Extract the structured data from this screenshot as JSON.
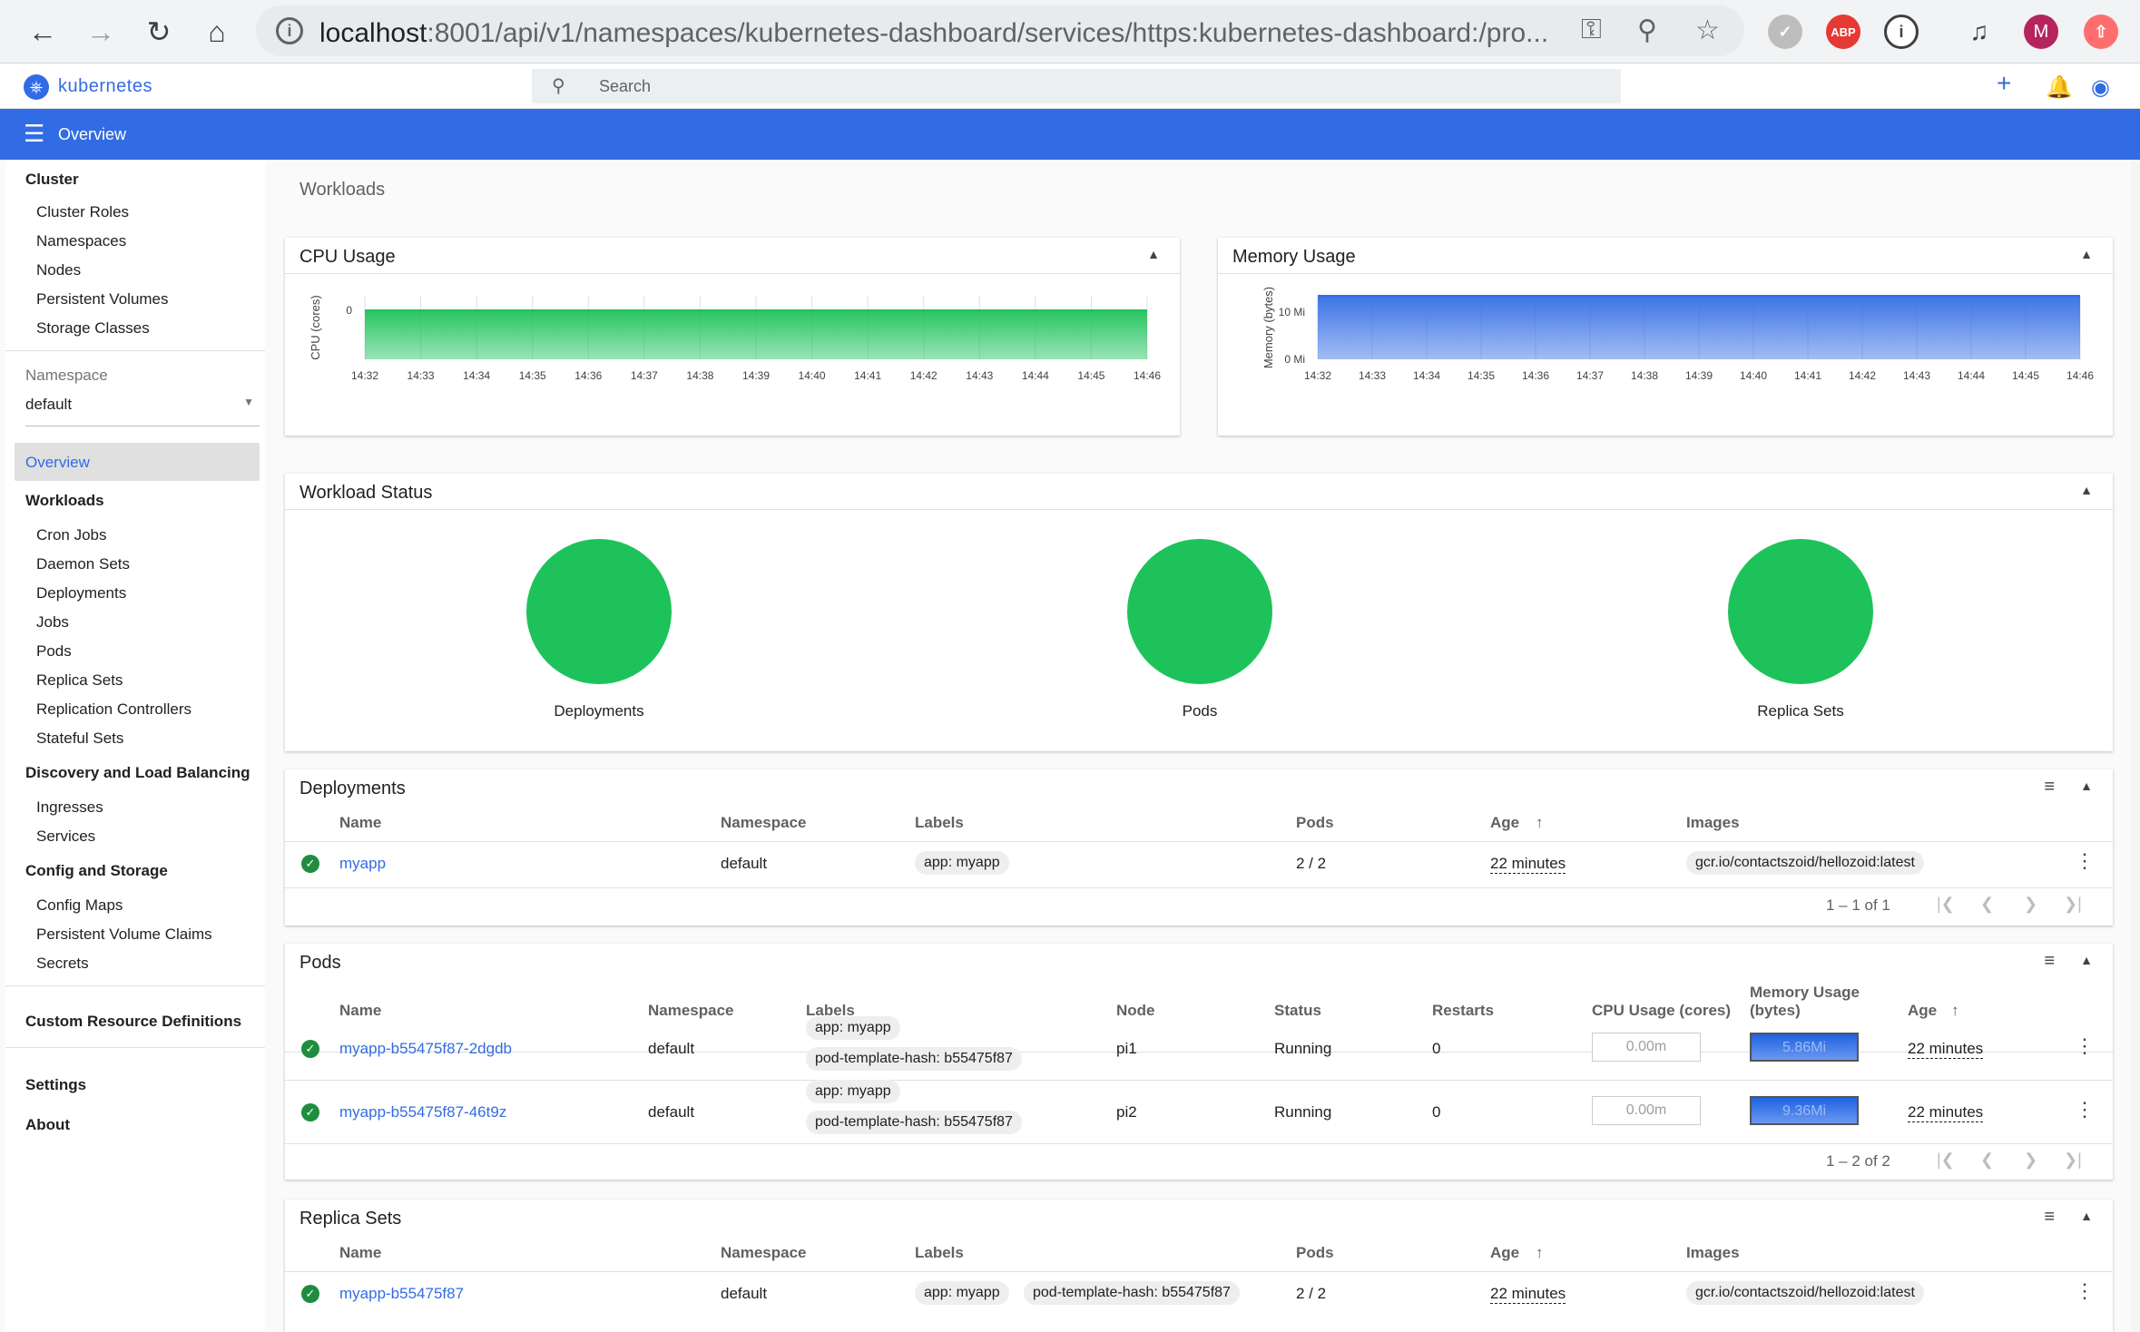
{
  "browser": {
    "url_host": "localhost",
    "url_rest": ":8001/api/v1/namespaces/kubernetes-dashboard/services/https:kubernetes-dashboard:/pro...",
    "profile_initial": "M",
    "abp_label": "ABP"
  },
  "header": {
    "brand": "kubernetes",
    "search_placeholder": "Search"
  },
  "toolbar": {
    "title": "Overview"
  },
  "sidebar": {
    "cluster": {
      "heading": "Cluster",
      "items": [
        "Cluster Roles",
        "Namespaces",
        "Nodes",
        "Persistent Volumes",
        "Storage Classes"
      ]
    },
    "namespace_label": "Namespace",
    "namespace_value": "default",
    "overview": "Overview",
    "workloads": {
      "heading": "Workloads",
      "items": [
        "Cron Jobs",
        "Daemon Sets",
        "Deployments",
        "Jobs",
        "Pods",
        "Replica Sets",
        "Replication Controllers",
        "Stateful Sets"
      ]
    },
    "discovery": {
      "heading": "Discovery and Load Balancing",
      "items": [
        "Ingresses",
        "Services"
      ]
    },
    "config": {
      "heading": "Config and Storage",
      "items": [
        "Config Maps",
        "Persistent Volume Claims",
        "Secrets"
      ]
    },
    "crd": "Custom Resource Definitions",
    "settings": "Settings",
    "about": "About"
  },
  "breadcrumb": "Workloads",
  "cpu_chart": {
    "title": "CPU Usage",
    "ylabel": "CPU (cores)",
    "ytick": "0",
    "xticks": [
      "14:32",
      "14:33",
      "14:34",
      "14:35",
      "14:36",
      "14:37",
      "14:38",
      "14:39",
      "14:40",
      "14:41",
      "14:42",
      "14:43",
      "14:44",
      "14:45",
      "14:46"
    ],
    "color": "#1ec25a"
  },
  "mem_chart": {
    "title": "Memory Usage",
    "ylabel": "Memory (bytes)",
    "yticks": [
      "10 Mi",
      "0 Mi"
    ],
    "xticks": [
      "14:32",
      "14:33",
      "14:34",
      "14:35",
      "14:36",
      "14:37",
      "14:38",
      "14:39",
      "14:40",
      "14:41",
      "14:42",
      "14:43",
      "14:44",
      "14:45",
      "14:46"
    ],
    "color": "#326ce5"
  },
  "workload_status": {
    "title": "Workload Status",
    "items": [
      "Deployments",
      "Pods",
      "Replica Sets"
    ]
  },
  "deployments": {
    "title": "Deployments",
    "columns": [
      "Name",
      "Namespace",
      "Labels",
      "Pods",
      "Age",
      "Images"
    ],
    "rows": [
      {
        "name": "myapp",
        "namespace": "default",
        "labels": [
          "app: myapp"
        ],
        "pods": "2 / 2",
        "age": "22 minutes",
        "image": "gcr.io/contactszoid/hellozoid:latest"
      }
    ],
    "pager": "1 – 1 of 1"
  },
  "pods": {
    "title": "Pods",
    "columns": [
      "Name",
      "Namespace",
      "Labels",
      "Node",
      "Status",
      "Restarts",
      "CPU Usage (cores)",
      "Memory Usage",
      "(bytes)",
      "Age"
    ],
    "rows": [
      {
        "name": "myapp-b55475f87-2dgdb",
        "namespace": "default",
        "label1": "app: myapp",
        "label2": "pod-template-hash: b55475f87",
        "node": "pi1",
        "status": "Running",
        "restarts": "0",
        "cpu": "0.00m",
        "mem": "5.86Mi",
        "age": "22 minutes"
      },
      {
        "name": "myapp-b55475f87-46t9z",
        "namespace": "default",
        "label1": "app: myapp",
        "label2": "pod-template-hash: b55475f87",
        "node": "pi2",
        "status": "Running",
        "restarts": "0",
        "cpu": "0.00m",
        "mem": "9.36Mi",
        "age": "22 minutes"
      }
    ],
    "pager": "1 – 2 of 2"
  },
  "replicasets": {
    "title": "Replica Sets",
    "columns": [
      "Name",
      "Namespace",
      "Labels",
      "Pods",
      "Age",
      "Images"
    ],
    "rows": [
      {
        "name": "myapp-b55475f87",
        "namespace": "default",
        "label1": "app: myapp",
        "label2": "pod-template-hash: b55475f87",
        "pods": "2 / 2",
        "age": "22 minutes",
        "image": "gcr.io/contactszoid/hellozoid:latest"
      }
    ]
  }
}
